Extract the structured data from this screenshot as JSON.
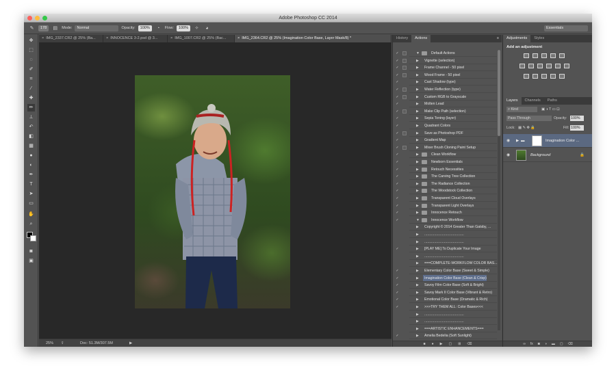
{
  "titlebar": {
    "title": "Adobe Photoshop CC 2014"
  },
  "window_controls": {
    "close_color": "#fc615d",
    "minimize_color": "#fdbc40",
    "zoom_color": "#34c84a"
  },
  "options_bar": {
    "brush_size": "178",
    "mode_label": "Mode:",
    "mode_value": "Normal",
    "opacity_label": "Opacity:",
    "opacity_value": "100%",
    "flow_label": "Flow:",
    "flow_value": "100%",
    "workspace": "Essentials"
  },
  "doc_tabs": [
    {
      "label": "IMG_2337.CR2 @ 25% (Ba..."
    },
    {
      "label": "INNOCENCE 3-2.psd @ 3..."
    },
    {
      "label": "IMG_1007.CR2 @ 25% (Bac..."
    },
    {
      "label": "IMG_2364.CR2 @ 25% (Imagination Color Base, Layer Mask/8) *"
    }
  ],
  "status_bar": {
    "zoom": "25%",
    "doc": "Doc: 51.3M/307.5M"
  },
  "history_panel": {
    "tab_history": "History",
    "tab_actions": "Actions"
  },
  "actions": [
    {
      "label": "Default Actions",
      "check": "✓",
      "dialog": true,
      "folder": true,
      "expanded": true
    },
    {
      "label": "Vignette (selection)",
      "check": "✓",
      "dialog": true
    },
    {
      "label": "Frame Channel - 50 pixel",
      "check": "✓",
      "dialog": true
    },
    {
      "label": "Wood Frame - 50 pixel",
      "check": "✓",
      "dialog": true
    },
    {
      "label": "Cast Shadow (type)",
      "check": "✓",
      "dialog": false
    },
    {
      "label": "Water Reflection (type)",
      "check": "✓",
      "dialog": true
    },
    {
      "label": "Custom RGB to Grayscale",
      "check": "✓",
      "dialog": true
    },
    {
      "label": "Molten Lead",
      "check": "✓",
      "dialog": false
    },
    {
      "label": "Make Clip Path (selection)",
      "check": "✓",
      "dialog": true
    },
    {
      "label": "Sepia Toning (layer)",
      "check": "✓",
      "dialog": false
    },
    {
      "label": "Quadrant Colors",
      "check": "✓",
      "dialog": false
    },
    {
      "label": "Save as Photoshop PDF",
      "check": "✓",
      "dialog": true
    },
    {
      "label": "Gradient Map",
      "check": "✓",
      "dialog": false
    },
    {
      "label": "Mixer Brush Cloning Paint Setup",
      "check": "✓",
      "dialog": true
    },
    {
      "label": "Clean Workflow",
      "check": "✓",
      "dialog": false,
      "folder": true
    },
    {
      "label": "Newborn Essentials",
      "check": "✓",
      "dialog": false,
      "folder": true
    },
    {
      "label": "Retouch Necessities",
      "check": "✓",
      "dialog": false,
      "folder": true
    },
    {
      "label": "The Carving Tree Collection",
      "check": "✓",
      "dialog": false,
      "folder": true
    },
    {
      "label": "The Radiance Collection",
      "check": "✓",
      "dialog": false,
      "folder": true
    },
    {
      "label": "The Woodstock Collection",
      "check": "✓",
      "dialog": false,
      "folder": true
    },
    {
      "label": "Transparent Cloud Overlays",
      "check": "✓",
      "dialog": false,
      "folder": true
    },
    {
      "label": "Transparent Light Overlays",
      "check": "✓",
      "dialog": false,
      "folder": true
    },
    {
      "label": "Innocence Retouch",
      "check": "✓",
      "dialog": false,
      "folder": true
    },
    {
      "label": "Innocence Workflow",
      "check": "✓",
      "dialog": false,
      "folder": true,
      "expanded": true
    },
    {
      "label": "Copyright © 2014 Greater Than Gatsby, ...",
      "check": "",
      "dialog": false
    },
    {
      "label": "........................................",
      "check": "",
      "dialog": false
    },
    {
      "label": "........................................",
      "check": "",
      "dialog": false
    },
    {
      "label": "[PLAY ME] To Duplicate Your Image",
      "check": "✓",
      "dialog": false
    },
    {
      "label": "........................................",
      "check": "",
      "dialog": false
    },
    {
      "label": "===COMPLETE-WORKFLOW COLOR BAS...",
      "check": "",
      "dialog": false
    },
    {
      "label": "Elementary Color Base   (Sweet & Simple)",
      "check": "✓",
      "dialog": false
    },
    {
      "label": "Imagination Color Base   (Clean & Crisp)",
      "check": "✓",
      "dialog": false,
      "selected": true
    },
    {
      "label": "Savoy Film Color Base   (Soft & Bright)",
      "check": "✓",
      "dialog": false
    },
    {
      "label": "Savoy Mark II Color Base   (Vibrant & Retro)",
      "check": "✓",
      "dialog": false
    },
    {
      "label": "Emotional Color Base   (Dramatic & Rich)",
      "check": "✓",
      "dialog": false
    },
    {
      "label": ">>>TRY THEM ALL: Color Bases<<<",
      "check": "✓",
      "dialog": false
    },
    {
      "label": "........................................",
      "check": "",
      "dialog": false
    },
    {
      "label": "........................................",
      "check": "",
      "dialog": false
    },
    {
      "label": "===ARTISTIC ENHANCEMENTS===",
      "check": "",
      "dialog": false
    },
    {
      "label": "Amelia Bedelia   (Soft Sunlight)",
      "check": "✓",
      "dialog": false
    }
  ],
  "adjustments_panel": {
    "tab_adjustments": "Adjustments",
    "tab_styles": "Styles",
    "title": "Add an adjustment"
  },
  "layers_panel": {
    "tab_layers": "Layers",
    "tab_channels": "Channels",
    "tab_paths": "Paths",
    "kind_filter": "Kind",
    "blend_mode": "Pass Through",
    "opacity_label": "Opacity:",
    "opacity_value": "100%",
    "lock_label": "Lock:",
    "fill_label": "Fill:",
    "fill_value": "100%",
    "layers": [
      {
        "name": "Imagination Color ...",
        "type": "group",
        "selected": true
      },
      {
        "name": "Background",
        "type": "image",
        "selected": false
      }
    ]
  }
}
